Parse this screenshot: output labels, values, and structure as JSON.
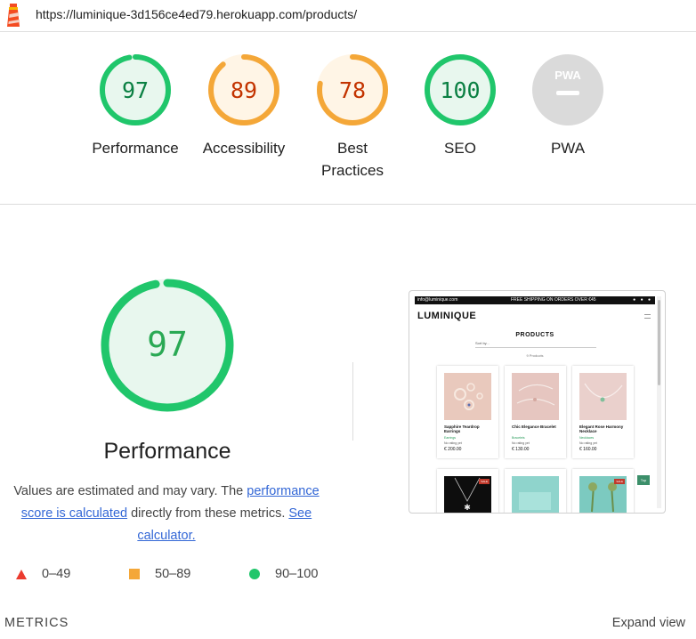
{
  "url": "https://luminique-3d156ce4ed79.herokuapp.com/products/",
  "colors": {
    "pass": "#0cce6b",
    "average": "#ffa400",
    "fail": "#ff4e42",
    "pwa": "#d9d9d9"
  },
  "categories": [
    {
      "label": "Performance",
      "score": "97",
      "value": 97,
      "status": "pass"
    },
    {
      "label": "Accessibility",
      "score": "89",
      "value": 89,
      "status": "average"
    },
    {
      "label_line1": "Best",
      "label_line2": "Practices",
      "score": "78",
      "value": 78,
      "status": "average"
    },
    {
      "label": "SEO",
      "score": "100",
      "value": 100,
      "status": "pass"
    },
    {
      "label": "PWA",
      "badge": "PWA",
      "status": "pwa"
    }
  ],
  "main": {
    "score": "97",
    "value": 97,
    "title": "Performance",
    "desc_prefix": "Values are estimated and may vary. The ",
    "desc_link1": "performance score is calculated",
    "desc_middle": " directly from these metrics. ",
    "desc_link2": "See calculator."
  },
  "legend": [
    {
      "range": "0–49",
      "icon": "triangle"
    },
    {
      "range": "50–89",
      "icon": "square"
    },
    {
      "range": "90–100",
      "icon": "circle"
    }
  ],
  "footer": {
    "metrics_label": "METRICS",
    "expand_label": "Expand view"
  },
  "thumbnail": {
    "topbar_left": "info@luminique.com",
    "topbar_center": "FREE SHIPPING ON ORDERS OVER €45",
    "brand": "LUMINIQUE",
    "page_title": "PRODUCTS",
    "sort_placeholder": "Sort by...",
    "count": "9 Products",
    "products": [
      {
        "name": "Sapphire Teardrop Earrings",
        "category": "Earrings",
        "rating": "No rating yet",
        "price": "€ 200.00"
      },
      {
        "name": "Chic Elegance Bracelet",
        "category": "Bracelets",
        "rating": "No rating yet",
        "price": "€ 130.00"
      },
      {
        "name": "Elegant Rose Harmony Necklace",
        "category": "Necklaces",
        "rating": "No rating yet",
        "price": "€ 160.00"
      }
    ],
    "sale_label": "SALE",
    "side_button": "Top"
  }
}
